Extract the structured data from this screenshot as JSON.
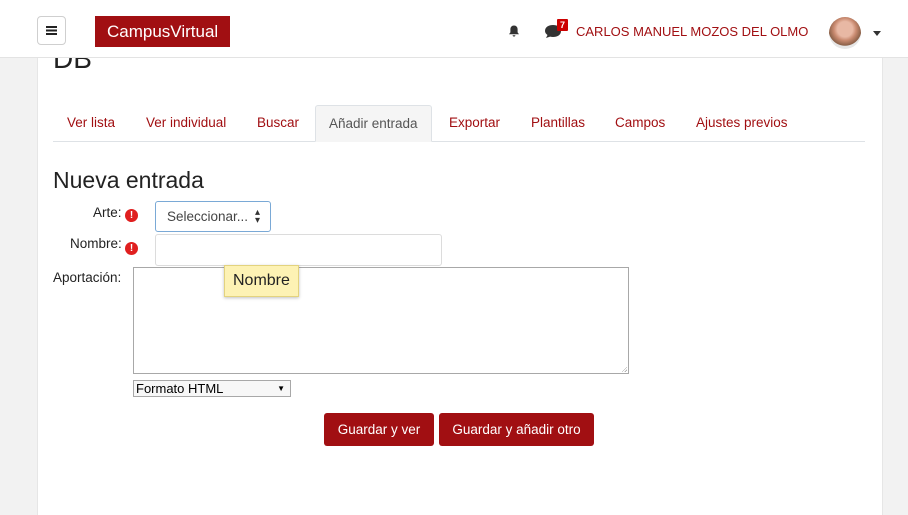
{
  "navbar": {
    "brand": "CampusVirtual",
    "notification_count": "7",
    "user_name": "CARLOS MANUEL MOZOS DEL OLMO",
    "icons": [
      "menu-icon",
      "bell-icon",
      "chat-icon",
      "avatar",
      "caret-down-icon"
    ]
  },
  "page": {
    "title": "DB"
  },
  "tabs": [
    {
      "label": "Ver lista"
    },
    {
      "label": "Ver individual"
    },
    {
      "label": "Buscar"
    },
    {
      "label": "Añadir entrada",
      "active": true
    },
    {
      "label": "Exportar"
    },
    {
      "label": "Plantillas"
    },
    {
      "label": "Campos"
    },
    {
      "label": "Ajustes previos"
    }
  ],
  "form": {
    "heading": "Nueva entrada",
    "arte_label": "Arte:",
    "arte_value": "Seleccionar...",
    "nombre_label": "Nombre:",
    "nombre_value": "",
    "aportacion_label": "Aportación:",
    "aportacion_value": "",
    "tooltip": "Nombre",
    "format_value": "Formato HTML",
    "required_icon": "exclamation-circle-icon"
  },
  "buttons": {
    "save_view": "Guardar y ver",
    "save_add": "Guardar y añadir otro"
  },
  "colors": {
    "brand": "#a10f12",
    "required": "#e01f1f",
    "tooltip": "#fdf2b4"
  }
}
